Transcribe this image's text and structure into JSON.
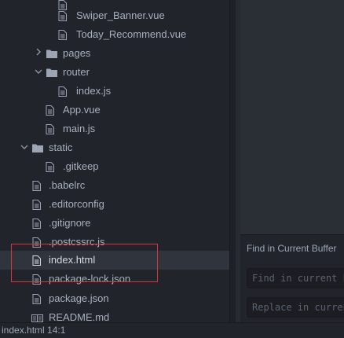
{
  "file_tree": {
    "items": [
      {
        "label": "Swiper_Banner.vue",
        "kind": "vue"
      },
      {
        "label": "Today_Recommend.vue",
        "kind": "vue"
      },
      {
        "label": "pages",
        "kind": "folder",
        "state": "collapsed"
      },
      {
        "label": "router",
        "kind": "folder",
        "state": "expanded"
      },
      {
        "label": "index.js",
        "kind": "js"
      },
      {
        "label": "App.vue",
        "kind": "vue"
      },
      {
        "label": "main.js",
        "kind": "js"
      },
      {
        "label": "static",
        "kind": "folder",
        "state": "expanded"
      },
      {
        "label": ".gitkeep",
        "kind": "file"
      },
      {
        "label": ".babelrc",
        "kind": "file"
      },
      {
        "label": ".editorconfig",
        "kind": "file"
      },
      {
        "label": ".gitignore",
        "kind": "file"
      },
      {
        "label": ".postcssrc.js",
        "kind": "file"
      },
      {
        "label": "index.html",
        "kind": "file",
        "selected": true
      },
      {
        "label": "package-lock.json",
        "kind": "file"
      },
      {
        "label": "package.json",
        "kind": "file"
      },
      {
        "label": "README.md",
        "kind": "markdown"
      }
    ]
  },
  "find_panel": {
    "title": "Find in Current Buffer",
    "find_placeholder": "Find in current buffer",
    "replace_placeholder": "Replace in current buffer"
  },
  "status_bar": {
    "text": "index.html  14:1"
  },
  "colors": {
    "highlight_box": "#e0303a",
    "selected_row": "#2f343d",
    "tree_text": "#a8b0bd",
    "background": "#21252b"
  }
}
